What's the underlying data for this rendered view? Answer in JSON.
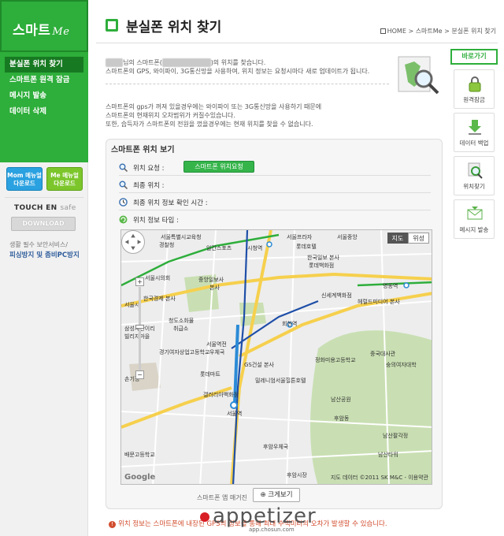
{
  "sidebar": {
    "logo": "스마트",
    "logo_suffix": "Me",
    "items": [
      {
        "label": "분실폰 위치 찾기"
      },
      {
        "label": "스마트폰 원격 잠금"
      },
      {
        "label": "메시지 발송"
      },
      {
        "label": "데이터 삭제"
      }
    ],
    "download_mom": {
      "line1": "Mom 메뉴얼",
      "line2": "다운로드"
    },
    "download_me": {
      "line1": "Me 메뉴얼",
      "line2": "다운로드"
    },
    "touchen_brand": "TOUCH EN",
    "touchen_safe": "safe",
    "touchen_button": "DOWNLOAD",
    "touchen_note1": "생활 필수 보안서비스/",
    "touchen_note2": "피싱방지 및 좀비PC방지"
  },
  "header": {
    "title": "분실폰 위치 찾기",
    "breadcrumb": [
      "HOME",
      "스마트Me",
      "분실폰 위치 찾기"
    ],
    "breadcrumb_sep": ">"
  },
  "intro": {
    "line1_suffix": "님의 스마트폰(",
    "line1_end": ")의 위치를 찾습니다.",
    "line2": "스마트폰의 GPS, 와이파이, 3G통신망을 사용하여, 위치 정보는 요청시마다 새로 업데이트가 됩니다."
  },
  "notes": [
    "스마트폰의 gps가 꺼져 있을경우에는 와이파이 또는 3G통신망을 사용하기 때문에",
    "스마트폰의 현재위치 오차범위가 커질수있습니다.",
    "또한, 습득자가 스마트폰의 전원을 껐을경우에는 현재 위치를 찾을 수 없습니다."
  ],
  "quick_menu": {
    "title": "바로가기",
    "items": [
      {
        "label": "원격잠금",
        "icon": "lock-icon"
      },
      {
        "label": "데이터 백업",
        "icon": "download-icon"
      },
      {
        "label": "위치찾기",
        "icon": "magnifier-icon"
      },
      {
        "label": "메시지 발송",
        "icon": "envelope-icon"
      }
    ]
  },
  "panel": {
    "title": "스마트폰 위치 보기",
    "rows": [
      {
        "label": "위치 요청 :"
      },
      {
        "label": "최종 위치 :"
      },
      {
        "label": "최종 위치 정보 확인 시간 :"
      },
      {
        "label": "위치 정보 타입 :"
      }
    ],
    "locate_button": "스마트폰 위치요청",
    "enlarge_button": "크게보기"
  },
  "map": {
    "type_options": [
      "지도",
      "위성"
    ],
    "selected_type": "지도",
    "labels": [
      "서울특별시교육청",
      "경찰청",
      "일간스포츠",
      "시청역",
      "서울프라자",
      "롯데호텔",
      "서울중앙",
      "롯데백화점",
      "중앙일보사",
      "본사",
      "서울시의회",
      "한국일보 본사",
      "명동역",
      "한국경제 본사",
      "신세계백화점",
      "회현역",
      "헤럴드미디어 본사",
      "청도소화물",
      "취급소",
      "경기여자상업고등학교",
      "서울역전",
      "우체국",
      "롯데마트",
      "GS건설 본사",
      "밀레니엄서울힐튼호텔",
      "갤러리아백화점",
      "서울역",
      "정화미용고등학교",
      "중국대사관",
      "숭의여자대학",
      "남산공원",
      "남산팔각정",
      "후암동",
      "후암우체국",
      "배문고등학교",
      "남산타워",
      "후암시장",
      "삼성사관이리",
      "빌리지마을",
      "손기정",
      "서울시"
    ],
    "copyright": "지도 데이터 ©2011 SK M&C - 이용약관",
    "google": "Google"
  },
  "footer_note": "위치 정보는 스마트폰에 내장된 GPS의 정보를 통해 최대 수백미터의 오차가 발생할 수 있습니다.",
  "watermark": {
    "small": "스마트폰 앱 매거진",
    "big": "appetizer",
    "url": "app.chosun.com"
  },
  "colors": {
    "brand_green": "#2eae3b",
    "button_green": "#35b44a",
    "warning": "#d24d2e",
    "link_blue": "#2f5d9c"
  }
}
